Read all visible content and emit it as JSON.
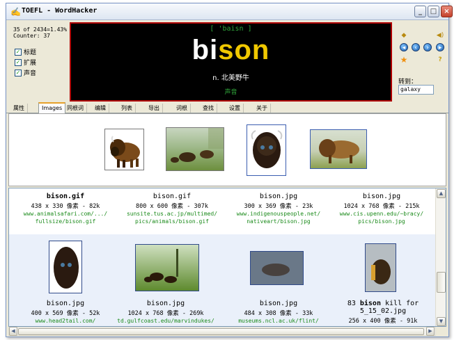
{
  "window": {
    "title": "TOEFL - WordHacker",
    "title_icon": "quill-icon",
    "minimize_label": "_",
    "maximize_label": "□",
    "close_label": "×"
  },
  "stats": {
    "progress": "35 of 2434=1.43%",
    "counter": "Counter: 37"
  },
  "options": [
    {
      "label": "标题",
      "checked": true
    },
    {
      "label": "扩展",
      "checked": true
    },
    {
      "label": "声音",
      "checked": true
    }
  ],
  "word": {
    "phonetic": "[ 'baisn ]",
    "part1": "bi",
    "part2": "son",
    "meaning": "n. 北美野牛",
    "sound_label": "声音"
  },
  "controls": {
    "icons": [
      "diamond-icon",
      "speaker-icon",
      "nav-first-icon",
      "nav-prev-icon",
      "nav-next-icon",
      "nav-last-icon",
      "star-icon",
      "help-icon"
    ],
    "goto_label": "转到：",
    "goto_value": "galaxy"
  },
  "tabs": [
    {
      "label": "属性",
      "active": false
    },
    {
      "label": "Images",
      "active": true
    },
    {
      "label": "同根词",
      "active": false
    },
    {
      "label": "编辑",
      "active": false
    },
    {
      "label": "列表",
      "active": false
    },
    {
      "label": "导出",
      "active": false
    },
    {
      "label": "词根",
      "active": false
    },
    {
      "label": "查找",
      "active": false
    },
    {
      "label": "设置",
      "active": false
    },
    {
      "label": "关于",
      "active": false
    }
  ],
  "results": {
    "row1": [
      {
        "name": "bison.gif",
        "size": "438 x 330 像素 - 82k",
        "url1": "www.animalsafari.com/.../",
        "url2": "fullsize/bison.gif"
      },
      {
        "name": "bison.gif",
        "size": "800 x 600 像素 - 307k",
        "url1": "sunsite.tus.ac.jp/multimed/",
        "url2": "pics/animals/bison.gif"
      },
      {
        "name": "bison.jpg",
        "size": "300 x 369 像素 - 23k",
        "url1": "www.indigenouspeople.net/",
        "url2": "nativeart/bison.jpg"
      },
      {
        "name": "bison.jpg",
        "size": "1024 x 768 像素 - 215k",
        "url1": "www.cis.upenn.edu/~bracy/",
        "url2": "pics/bison.jpg"
      }
    ],
    "row2": [
      {
        "name": "bison.jpg",
        "size": "400 x 569 像素 - 52k",
        "url1": "www.head2tail.com/"
      },
      {
        "name": "bison.jpg",
        "size": "1024 x 768 像素 - 269k",
        "url1": "td.gulfcoast.edu/marvindukes/"
      },
      {
        "name": "bison.jpg",
        "size": "484 x 308 像素 - 33k",
        "url1": "museums.ncl.ac.uk/flint/"
      },
      {
        "name_pre": "83 ",
        "name_bold": "bison",
        "name_post": " kill for",
        "name_line2": "5_15_02.jpg",
        "size": "256 x 400 像素 - 91k"
      }
    ]
  },
  "scrollbars": {
    "up": "▲",
    "down": "▼",
    "left": "◀",
    "right": "▶"
  }
}
